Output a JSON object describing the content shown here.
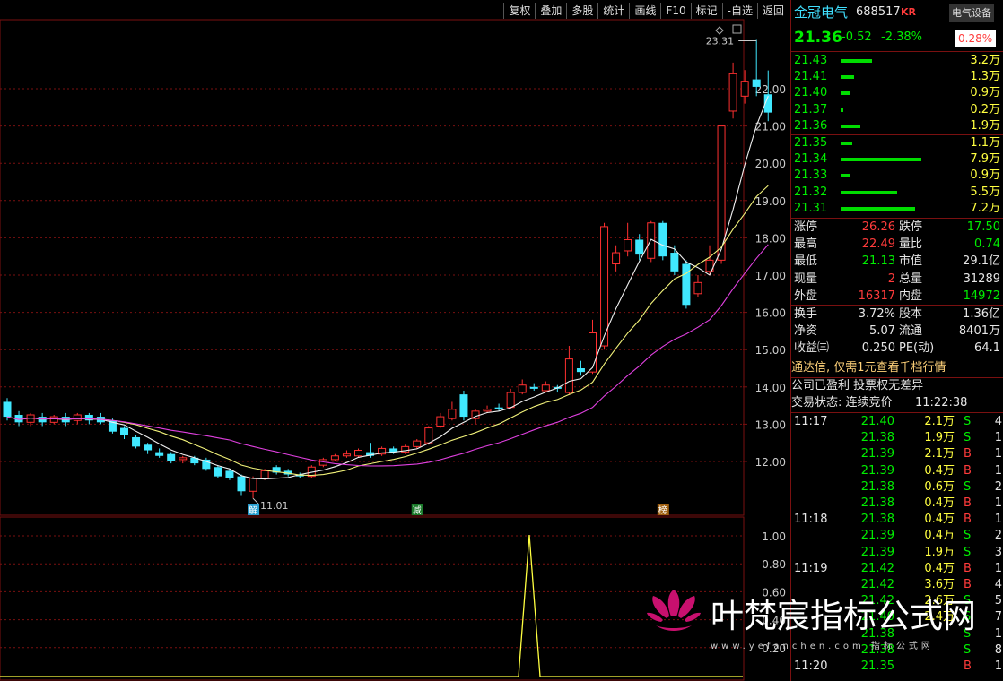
{
  "toolbar": [
    "复权",
    "叠加",
    "多股",
    "统计",
    "画线",
    "F10",
    "标记",
    "-自选",
    "返回"
  ],
  "stock": {
    "name": "金冠电气",
    "code": "688517",
    "badge": "KR",
    "sector": "电气设备",
    "price": "21.36",
    "change": "-0.52",
    "change_pct": "-2.38%",
    "sector_pct": "0.28%"
  },
  "asks": [
    {
      "price": "21.43",
      "vol": "3.2万",
      "bar": 0.32
    },
    {
      "price": "21.41",
      "vol": "1.3万",
      "bar": 0.14
    },
    {
      "price": "21.40",
      "vol": "0.9万",
      "bar": 0.1
    },
    {
      "price": "21.37",
      "vol": "0.2万",
      "bar": 0.03
    },
    {
      "price": "21.36",
      "vol": "1.9万",
      "bar": 0.2
    }
  ],
  "bids": [
    {
      "price": "21.35",
      "vol": "1.1万",
      "bar": 0.12
    },
    {
      "price": "21.34",
      "vol": "7.9万",
      "bar": 0.82
    },
    {
      "price": "21.33",
      "vol": "0.9万",
      "bar": 0.1
    },
    {
      "price": "21.32",
      "vol": "5.5万",
      "bar": 0.57
    },
    {
      "price": "21.31",
      "vol": "7.2万",
      "bar": 0.75
    }
  ],
  "stats1": [
    {
      "l1": "涨停",
      "v1": "26.26",
      "c1": "red",
      "l2": "跌停",
      "v2": "17.50",
      "c2": "green"
    },
    {
      "l1": "最高",
      "v1": "22.49",
      "c1": "red",
      "l2": "量比",
      "v2": "0.74",
      "c2": "green"
    },
    {
      "l1": "最低",
      "v1": "21.13",
      "c1": "green",
      "l2": "市值",
      "v2": "29.1亿",
      "c2": "white"
    },
    {
      "l1": "现量",
      "v1": "2",
      "c1": "red",
      "l2": "总量",
      "v2": "31289",
      "c2": "white"
    },
    {
      "l1": "外盘",
      "v1": "16317",
      "c1": "red",
      "l2": "内盘",
      "v2": "14972",
      "c2": "green"
    }
  ],
  "stats2": [
    {
      "l1": "换手",
      "v1": "3.72%",
      "c1": "white",
      "l2": "股本",
      "v2": "1.36亿",
      "c2": "white"
    },
    {
      "l1": "净资",
      "v1": "5.07",
      "c1": "white",
      "l2": "流通",
      "v2": "8401万",
      "c2": "white"
    },
    {
      "l1": "收益㈢",
      "v1": "0.250",
      "c1": "white",
      "l2": "PE(动)",
      "v2": "64.1",
      "c2": "white"
    }
  ],
  "notice1": "通达信, 仅需1元查看千档行情",
  "notice2": "公司已盈利 投票权无差异",
  "status_label": "交易状态: 连续竞价",
  "status_time": "11:22:38",
  "ticks": [
    {
      "t": "11:17",
      "p": "21.40",
      "v": "2.1万",
      "d": "S",
      "n": "4"
    },
    {
      "t": "",
      "p": "21.38",
      "v": "1.9万",
      "d": "S",
      "n": "1"
    },
    {
      "t": "",
      "p": "21.39",
      "v": "2.1万",
      "d": "B",
      "n": "1"
    },
    {
      "t": "",
      "p": "21.39",
      "v": "0.4万",
      "d": "B",
      "n": "1"
    },
    {
      "t": "",
      "p": "21.38",
      "v": "0.6万",
      "d": "S",
      "n": "2"
    },
    {
      "t": "",
      "p": "21.38",
      "v": "0.4万",
      "d": "B",
      "n": "1"
    },
    {
      "t": "11:18",
      "p": "21.38",
      "v": "0.4万",
      "d": "B",
      "n": "1"
    },
    {
      "t": "",
      "p": "21.39",
      "v": "0.4万",
      "d": "S",
      "n": "2"
    },
    {
      "t": "",
      "p": "21.39",
      "v": "1.9万",
      "d": "S",
      "n": "3"
    },
    {
      "t": "11:19",
      "p": "21.42",
      "v": "0.4万",
      "d": "B",
      "n": "1"
    },
    {
      "t": "",
      "p": "21.42",
      "v": "3.6万",
      "d": "B",
      "n": "4"
    },
    {
      "t": "",
      "p": "21.42",
      "v": "2.6万",
      "d": "S",
      "n": "5"
    },
    {
      "t": "",
      "p": "21.40",
      "v": "2.4万",
      "d": "S",
      "n": "7"
    },
    {
      "t": "",
      "p": "21.38",
      "v": "",
      "d": "S",
      "n": "1"
    },
    {
      "t": "",
      "p": "21.38",
      "v": "",
      "d": "S",
      "n": "8"
    },
    {
      "t": "11:20",
      "p": "21.35",
      "v": "",
      "d": "B",
      "n": "1"
    }
  ],
  "chart_data": {
    "type": "candlestick",
    "price_axis": {
      "ticks": [
        "22.00",
        "21.00",
        "20.00",
        "19.00",
        "18.00",
        "17.00",
        "16.00",
        "15.00",
        "14.00",
        "13.00",
        "12.00"
      ],
      "range": [
        11.0,
        23.31
      ]
    },
    "high_label": "23.31",
    "low_label": "11.01",
    "markers": [
      "解",
      "减",
      "榜"
    ],
    "candles": [
      [
        13.6,
        13.2,
        13.7,
        13.1
      ],
      [
        13.25,
        13.05,
        13.35,
        12.95
      ],
      [
        13.05,
        13.25,
        13.3,
        12.95
      ],
      [
        13.2,
        13.05,
        13.3,
        12.95
      ],
      [
        13.05,
        13.2,
        13.25,
        13.0
      ],
      [
        13.2,
        13.05,
        13.3,
        12.95
      ],
      [
        13.1,
        13.25,
        13.3,
        13.0
      ],
      [
        13.25,
        13.1,
        13.3,
        13.0
      ],
      [
        13.2,
        13.05,
        13.3,
        13.0
      ],
      [
        13.1,
        12.8,
        13.15,
        12.75
      ],
      [
        12.9,
        12.7,
        12.95,
        12.6
      ],
      [
        12.65,
        12.4,
        12.7,
        12.35
      ],
      [
        12.45,
        12.3,
        12.5,
        12.2
      ],
      [
        12.25,
        12.15,
        12.35,
        12.1
      ],
      [
        12.2,
        12.0,
        12.25,
        11.95
      ],
      [
        12.05,
        12.1,
        12.15,
        11.95
      ],
      [
        12.1,
        11.95,
        12.15,
        11.9
      ],
      [
        12.05,
        11.8,
        12.1,
        11.75
      ],
      [
        11.85,
        11.6,
        11.9,
        11.55
      ],
      [
        11.75,
        11.55,
        11.8,
        11.5
      ],
      [
        11.6,
        11.2,
        11.65,
        11.1
      ],
      [
        11.2,
        11.55,
        11.6,
        11.01
      ],
      [
        11.55,
        11.75,
        11.8,
        11.5
      ],
      [
        11.85,
        11.7,
        11.9,
        11.65
      ],
      [
        11.75,
        11.65,
        11.8,
        11.6
      ],
      [
        11.65,
        11.6,
        11.7,
        11.55
      ],
      [
        11.6,
        11.85,
        11.9,
        11.55
      ],
      [
        11.9,
        12.05,
        12.1,
        11.85
      ],
      [
        12.05,
        12.15,
        12.2,
        12.0
      ],
      [
        12.15,
        12.2,
        12.3,
        12.1
      ],
      [
        12.15,
        12.3,
        12.35,
        12.1
      ],
      [
        12.25,
        12.15,
        12.5,
        12.1
      ],
      [
        12.2,
        12.35,
        12.4,
        12.15
      ],
      [
        12.35,
        12.25,
        12.4,
        12.2
      ],
      [
        12.25,
        12.4,
        12.45,
        12.2
      ],
      [
        12.4,
        12.55,
        12.6,
        12.35
      ],
      [
        12.5,
        12.9,
        12.95,
        12.45
      ],
      [
        12.95,
        13.2,
        13.3,
        12.9
      ],
      [
        13.15,
        13.4,
        13.6,
        13.1
      ],
      [
        13.8,
        13.2,
        13.9,
        13.1
      ],
      [
        13.15,
        13.35,
        13.4,
        13.0
      ],
      [
        13.35,
        13.4,
        13.5,
        13.3
      ],
      [
        13.45,
        13.4,
        13.55,
        13.35
      ],
      [
        13.45,
        13.85,
        13.95,
        13.4
      ],
      [
        13.85,
        14.05,
        14.2,
        13.8
      ],
      [
        14.0,
        13.95,
        14.1,
        13.9
      ],
      [
        13.9,
        14.05,
        14.15,
        13.85
      ],
      [
        14.0,
        13.95,
        14.05,
        13.85
      ],
      [
        13.85,
        14.75,
        15.1,
        13.8
      ],
      [
        14.5,
        14.4,
        14.7,
        14.3
      ],
      [
        14.4,
        15.45,
        15.8,
        14.35
      ],
      [
        15.1,
        18.3,
        18.4,
        15.0
      ],
      [
        17.3,
        17.6,
        17.8,
        17.1
      ],
      [
        17.65,
        17.95,
        18.4,
        17.5
      ],
      [
        17.95,
        17.55,
        18.1,
        17.4
      ],
      [
        17.45,
        18.4,
        18.45,
        17.35
      ],
      [
        18.4,
        17.5,
        18.45,
        17.4
      ],
      [
        17.6,
        17.1,
        17.8,
        17.0
      ],
      [
        17.3,
        16.2,
        17.4,
        16.1
      ],
      [
        16.5,
        16.8,
        17.0,
        16.4
      ],
      [
        17.1,
        17.4,
        17.8,
        17.0
      ],
      [
        17.4,
        21.0,
        21.0,
        17.3
      ],
      [
        21.4,
        22.4,
        22.7,
        21.2
      ],
      [
        21.8,
        22.2,
        22.5,
        21.6
      ],
      [
        22.25,
        22.05,
        23.31,
        21.8
      ],
      [
        21.85,
        21.36,
        22.49,
        21.13
      ]
    ]
  }
}
